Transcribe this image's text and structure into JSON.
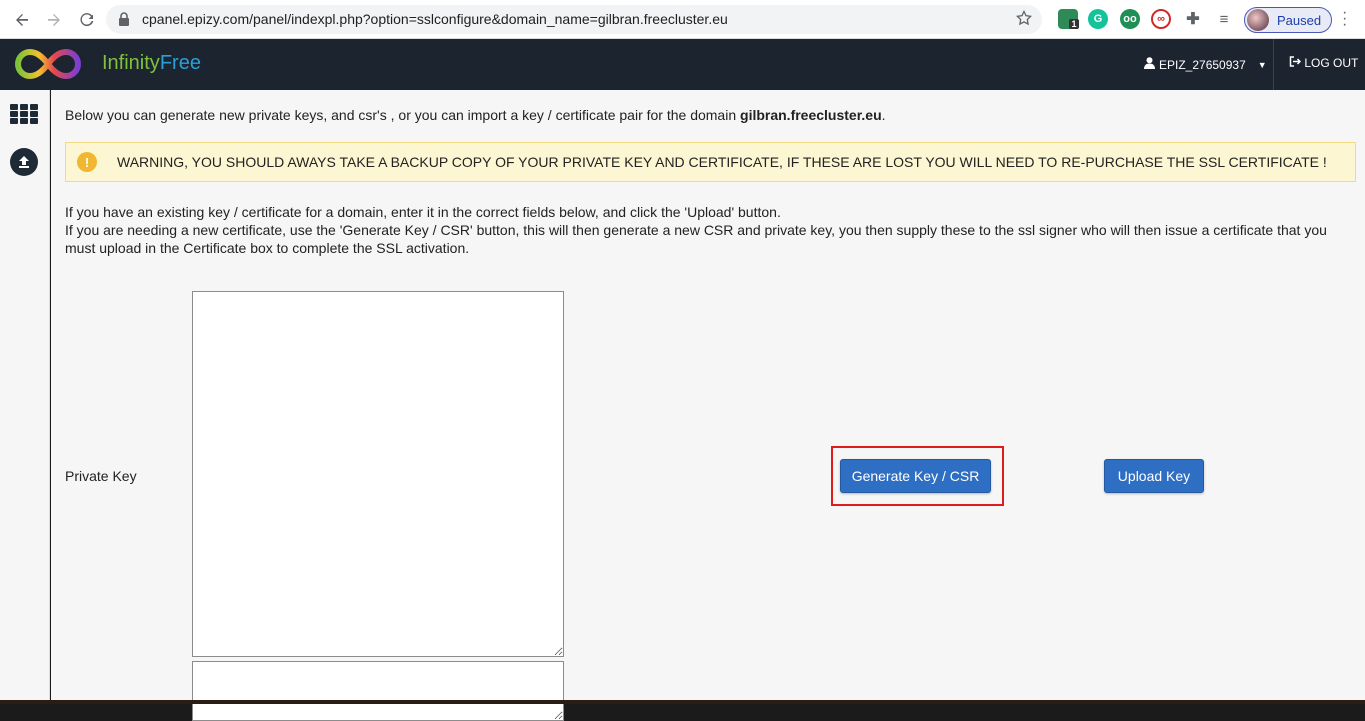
{
  "browser": {
    "url": "cpanel.epizy.com/panel/indexpl.php?option=sslconfigure&domain_name=gilbran.freecluster.eu",
    "profile_status": "Paused",
    "extension_badge": "1"
  },
  "header": {
    "brand_part1": "Infinity",
    "brand_part2": "Free",
    "username": "EPIZ_27650937",
    "logout_label": "LOG OUT"
  },
  "content": {
    "intro_text": "Below you can generate new private keys, and csr's , or you can import a key / certificate pair for the domain ",
    "domain": "gilbran.freecluster.eu",
    "intro_suffix": ".",
    "warning_text": "WARNING, YOU SHOULD AWAYS TAKE A BACKUP COPY OF YOUR PRIVATE KEY AND CERTIFICATE, IF THESE ARE LOST YOU WILL NEED TO RE-PURCHASE THE SSL CERTIFICATE !",
    "help_line1": "If you have an existing key / certificate for a domain, enter it in the correct fields below, and click the 'Upload' button.",
    "help_line2": "If you are needing a new certificate, use the 'Generate Key / CSR' button, this will then generate a new CSR and private key, you then supply these to the ssl signer who will then issue a certificate that you must upload in the Certificate box to complete the SSL activation.",
    "private_key_label": "Private Key",
    "generate_button": "Generate Key / CSR",
    "upload_button": "Upload Key"
  },
  "colors": {
    "header_bg": "#1c2430",
    "button_bg": "#2e6fc4",
    "warning_bg": "#fdf6d3",
    "highlight": "#e01b1b"
  }
}
